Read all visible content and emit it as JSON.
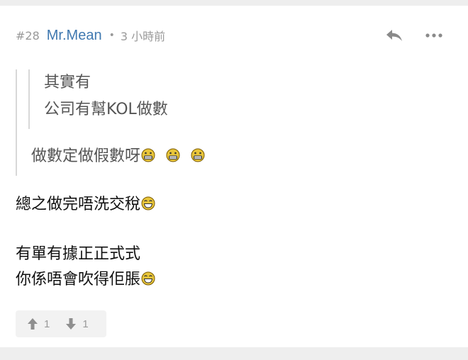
{
  "post": {
    "floor": "#28",
    "author": "Mr.Mean",
    "separator": "•",
    "time": "3 小時前"
  },
  "actions": {
    "reply_icon": "reply-icon",
    "more_icon": "more-icon"
  },
  "quote": {
    "nested_lines": [
      "其實有",
      "公司有幫KOL做數"
    ],
    "reply_line": "做數定做假數呀"
  },
  "body": {
    "lines": [
      "總之做完唔洗交稅",
      "有單有據正正式式",
      "你係唔會吹得佢脹"
    ]
  },
  "votes": {
    "up_count": "1",
    "down_count": "1"
  },
  "colors": {
    "author": "#3f78b0",
    "meta": "#9a9a9a",
    "emoji_face": "#e8c53a"
  }
}
